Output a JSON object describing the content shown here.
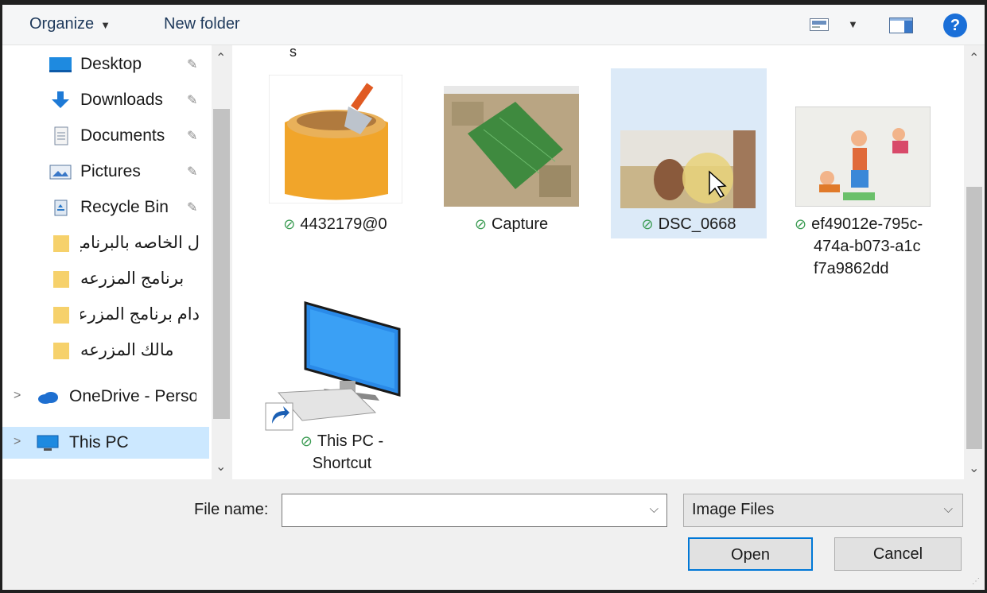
{
  "toolbar": {
    "organize_label": "Organize",
    "new_folder_label": "New folder"
  },
  "nav": {
    "items": [
      {
        "label": "Desktop",
        "icon": "desktop-icon",
        "pinned": true
      },
      {
        "label": "Downloads",
        "icon": "download-icon",
        "pinned": true
      },
      {
        "label": "Documents",
        "icon": "documents-icon",
        "pinned": true
      },
      {
        "label": "Pictures",
        "icon": "pictures-icon",
        "pinned": true
      },
      {
        "label": "Recycle Bin",
        "icon": "recycle-bin-icon",
        "pinned": true
      },
      {
        "label": "ل الخاصه بالبرنامج",
        "icon": "folder-icon"
      },
      {
        "label": "برنامج المزرعه",
        "icon": "folder-icon"
      },
      {
        "label": "دام برنامج المزرعه",
        "icon": "folder-icon"
      },
      {
        "label": "مالك المزرعه",
        "icon": "folder-icon"
      },
      {
        "label": "OneDrive - Persor",
        "icon": "onedrive-icon"
      },
      {
        "label": "This PC",
        "icon": "this-pc-icon",
        "selected": true
      }
    ]
  },
  "content": {
    "partial_label": "s",
    "files": [
      {
        "name": "4432179@0",
        "status": "synced"
      },
      {
        "name": "Capture",
        "status": "synced"
      },
      {
        "name": "DSC_0668",
        "status": "synced",
        "selected": true
      },
      {
        "name_lines": [
          "ef49012e-795c-",
          "474a-b073-a1c",
          "f7a9862dd"
        ],
        "status": "synced"
      },
      {
        "name_lines": [
          "This PC -",
          "Shortcut"
        ],
        "status": "synced"
      }
    ]
  },
  "footer": {
    "file_name_label": "File name:",
    "file_name_value": "",
    "file_type_value": "Image Files",
    "open_label": "Open",
    "cancel_label": "Cancel"
  },
  "colors": {
    "accent": "#0078d7",
    "selection": "#cce8ff",
    "synced_check": "#3a9b52",
    "help": "#1a6fd8"
  }
}
